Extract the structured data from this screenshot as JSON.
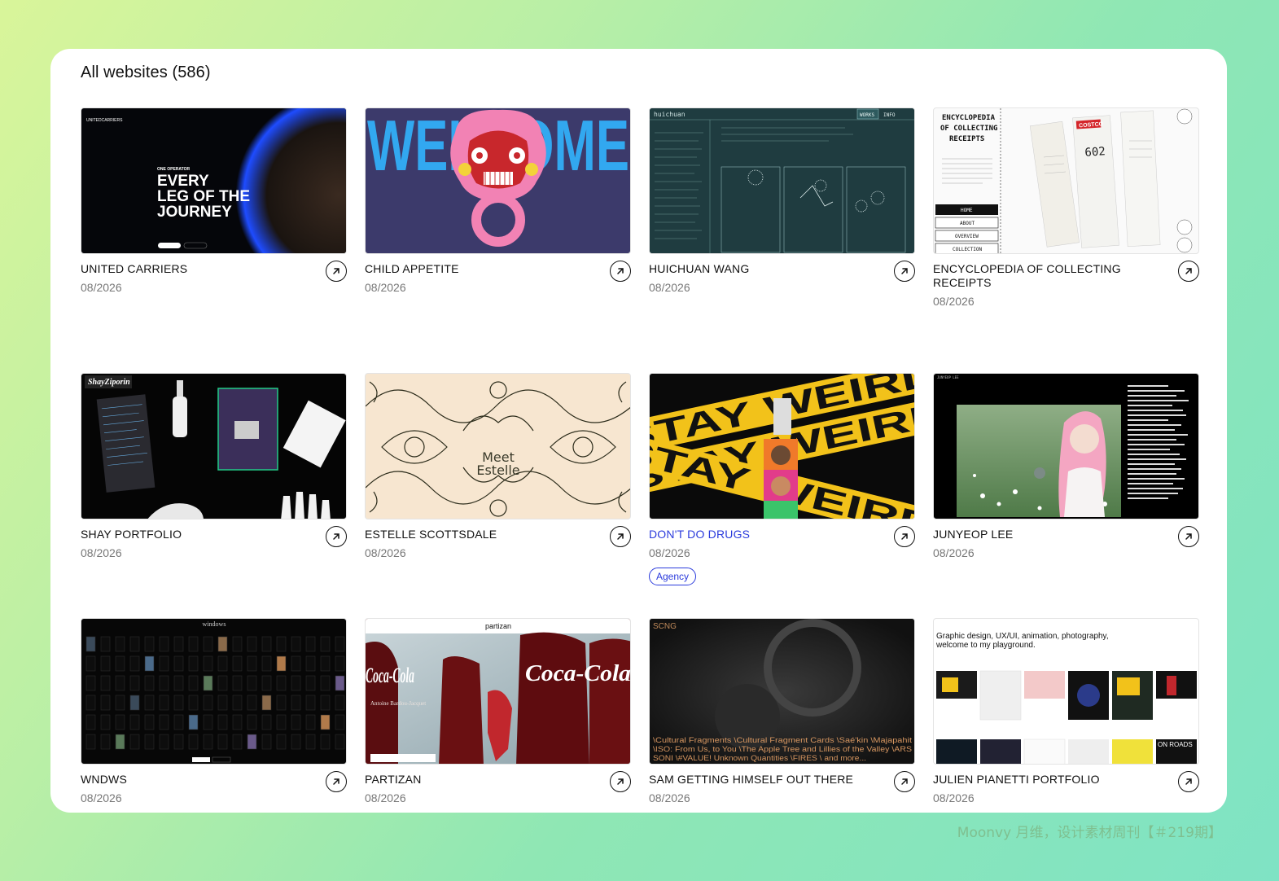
{
  "header": {
    "title": "All websites (586)"
  },
  "cards": [
    {
      "name": "UNITED CARRIERS",
      "date": "08/2026",
      "thumb_text": [
        "ONE OPERATOR",
        "EVERY",
        "LEG OF THE",
        "JOURNEY",
        "UNITEDCARRIERS"
      ]
    },
    {
      "name": "CHILD APPETITE",
      "date": "08/2026",
      "thumb_text": [
        "WELCOME"
      ]
    },
    {
      "name": "HUICHUAN WANG",
      "date": "08/2026",
      "thumb_text": [
        "huichuan",
        "WORKS",
        "INFO"
      ]
    },
    {
      "name": "ENCYCLOPEDIA OF COLLECTING RECEIPTS",
      "date": "08/2026",
      "thumb_text": [
        "ENCYCLOPEDIA",
        "OF COLLECTING",
        "RECEIPTS",
        "HOME",
        "ABOUT",
        "OVERVIEW",
        "COLLECTION",
        "602",
        "COSTCO"
      ]
    },
    {
      "name": "SHAY PORTFOLIO",
      "date": "08/2026",
      "thumb_text": [
        "ShayZiporin"
      ]
    },
    {
      "name": "ESTELLE SCOTTSDALE",
      "date": "08/2026",
      "thumb_text": [
        "Meet",
        "Estelle"
      ]
    },
    {
      "name": "DON'T DO DRUGS",
      "date": "08/2026",
      "tag": "Agency",
      "thumb_text": [
        "STAY WEIRD"
      ]
    },
    {
      "name": "JUNYEOP LEE",
      "date": "08/2026",
      "thumb_text": [
        "JUNYEOP LEE"
      ]
    },
    {
      "name": "WNDWS",
      "date": "08/2026",
      "thumb_text": [
        "windows"
      ]
    },
    {
      "name": "PARTIZAN",
      "date": "08/2026",
      "thumb_text": [
        "partizan",
        "Coca-Cola",
        "Antoine Bardou-Jacquet"
      ]
    },
    {
      "name": "SAM GETTING HIMSELF OUT THERE",
      "date": "08/2026",
      "thumb_text": [
        "SCNG",
        "\\Cultural Fragments \\Cultural Fragment Cards \\Saé'kin \\Majapahit",
        "\\ISO: From Us, to You \\The Apple Tree and Lillies of the Valley \\ARS",
        "SONI \\#VALUE! Unknown Quantities \\FIRES \\ and more..."
      ]
    },
    {
      "name": "JULIEN PIANETTI PORTFOLIO",
      "date": "08/2026",
      "thumb_text": [
        "Graphic design, UX/UI, animation, photography,",
        "welcome to my playground.",
        "ON ROADS"
      ]
    }
  ],
  "footer": {
    "caption": "Moonvy 月维，设计素材周刊【＃219期】"
  },
  "colors": {
    "link": "#2b3bdc",
    "text": "#111111",
    "muted": "#777777",
    "panel": "#ffffff"
  },
  "icons": {
    "card_action": "arrow-up-right-icon"
  }
}
